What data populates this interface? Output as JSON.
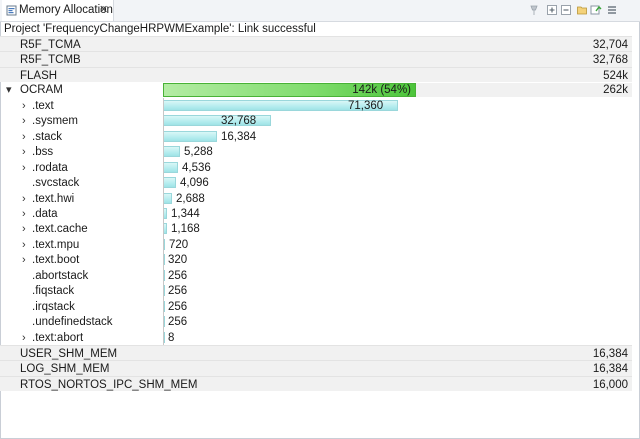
{
  "tab": {
    "title": "Memory Allocation",
    "close": "✕"
  },
  "toolbar": [
    {
      "name": "pin-icon"
    },
    {
      "name": "expand-all-icon"
    },
    {
      "name": "collapse-all-icon"
    },
    {
      "name": "open-file-icon"
    },
    {
      "name": "refresh-icon"
    },
    {
      "name": "view-menu-icon"
    }
  ],
  "status": "Project 'FrequencyChangeHRPWMExample': Link successful",
  "regions_top": [
    {
      "name": "R5F_TCMA",
      "size": "32,704"
    },
    {
      "name": "R5F_TCMB",
      "size": "32,768"
    },
    {
      "name": "FLASH",
      "size": "524k"
    }
  ],
  "ocram": {
    "name": "OCRAM",
    "bar_label": "142k (54%)",
    "size": "262k",
    "fraction": 0.54
  },
  "sections": [
    {
      "name": ".text",
      "value": "71,360",
      "bytes": 71360,
      "expandable": true
    },
    {
      "name": ".sysmem",
      "value": "32,768",
      "bytes": 32768,
      "expandable": true
    },
    {
      "name": ".stack",
      "value": "16,384",
      "bytes": 16384,
      "expandable": true
    },
    {
      "name": ".bss",
      "value": "5,288",
      "bytes": 5288,
      "expandable": true
    },
    {
      "name": ".rodata",
      "value": "4,536",
      "bytes": 4536,
      "expandable": true
    },
    {
      "name": ".svcstack",
      "value": "4,096",
      "bytes": 4096,
      "expandable": false
    },
    {
      "name": ".text.hwi",
      "value": "2,688",
      "bytes": 2688,
      "expandable": true
    },
    {
      "name": ".data",
      "value": "1,344",
      "bytes": 1344,
      "expandable": true
    },
    {
      "name": ".text.cache",
      "value": "1,168",
      "bytes": 1168,
      "expandable": true
    },
    {
      "name": ".text.mpu",
      "value": "720",
      "bytes": 720,
      "expandable": true
    },
    {
      "name": ".text.boot",
      "value": "320",
      "bytes": 320,
      "expandable": true
    },
    {
      "name": ".abortstack",
      "value": "256",
      "bytes": 256,
      "expandable": false
    },
    {
      "name": ".fiqstack",
      "value": "256",
      "bytes": 256,
      "expandable": false
    },
    {
      "name": ".irqstack",
      "value": "256",
      "bytes": 256,
      "expandable": false
    },
    {
      "name": ".undefinedstack",
      "value": "256",
      "bytes": 256,
      "expandable": false
    },
    {
      "name": ".text:abort",
      "value": "8",
      "bytes": 8,
      "expandable": true
    }
  ],
  "regions_bottom": [
    {
      "name": "USER_SHM_MEM",
      "size": "16,384"
    },
    {
      "name": "LOG_SHM_MEM",
      "size": "16,384"
    },
    {
      "name": "RTOS_NORTOS_IPC_SHM_MEM",
      "size": "16,000"
    }
  ],
  "icons": {
    "expanded": "▾",
    "collapsed": "›"
  }
}
